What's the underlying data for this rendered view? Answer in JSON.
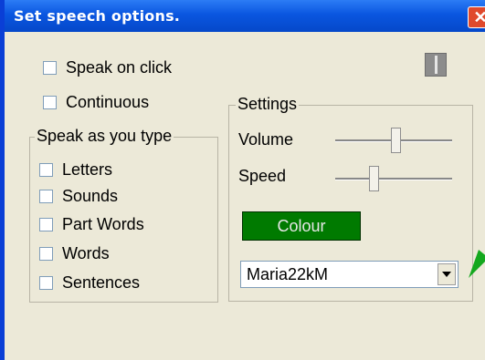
{
  "title": "Set speech options.",
  "close_glyph": "✕",
  "options": {
    "speak_on_click": "Speak on click",
    "continuous": "Continuous"
  },
  "speak_as_you_type": {
    "label": "Speak as you type",
    "items": [
      "Letters",
      "Sounds",
      "Part Words",
      "Words",
      "Sentences"
    ]
  },
  "settings": {
    "label": "Settings",
    "volume_label": "Volume",
    "speed_label": "Speed",
    "volume_level": 0.52,
    "speed_level": 0.33,
    "colour_button": "Colour",
    "voice_value": "Maria22kM"
  },
  "colors": {
    "titlebar": "#0a56e0",
    "colour_button_bg": "#007a00",
    "pointer": "#14a81e"
  }
}
